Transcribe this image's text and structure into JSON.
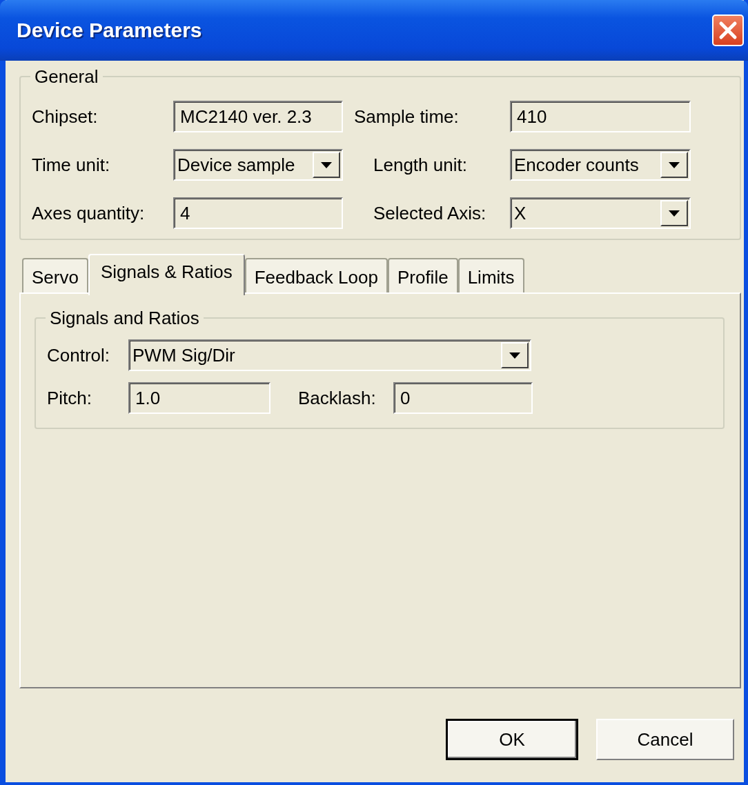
{
  "window": {
    "title": "Device Parameters"
  },
  "general": {
    "title": "General",
    "rows": [
      [
        {
          "label": "Chipset:",
          "value": "MC2140 ver. 2.3",
          "kind": "text"
        },
        {
          "label": "Sample time:",
          "value": "410",
          "kind": "text"
        }
      ],
      [
        {
          "label": "Time unit:",
          "value": "Device sample",
          "kind": "dropdown"
        },
        {
          "label": "Length unit:",
          "value": "Encoder counts",
          "kind": "dropdown"
        }
      ],
      [
        {
          "label": "Axes quantity:",
          "value": "4",
          "kind": "text"
        },
        {
          "label": "Selected Axis:",
          "value": "X",
          "kind": "dropdown"
        }
      ]
    ]
  },
  "tabs": [
    {
      "label": "Servo",
      "selected": false
    },
    {
      "label": "Signals & Ratios",
      "selected": true
    },
    {
      "label": "Feedback Loop",
      "selected": false
    },
    {
      "label": "Profile",
      "selected": false
    },
    {
      "label": "Limits",
      "selected": false
    }
  ],
  "signals": {
    "title": "Signals and Ratios",
    "control": {
      "label": "Control:",
      "value": "PWM Sig/Dir",
      "kind": "dropdown"
    },
    "pitch": {
      "label": "Pitch:",
      "value": "1.0",
      "kind": "text"
    },
    "backlash": {
      "label": "Backlash:",
      "value": "0",
      "kind": "text"
    }
  },
  "buttons": [
    {
      "label": "OK",
      "default": true
    },
    {
      "label": "Cancel",
      "default": false
    }
  ]
}
